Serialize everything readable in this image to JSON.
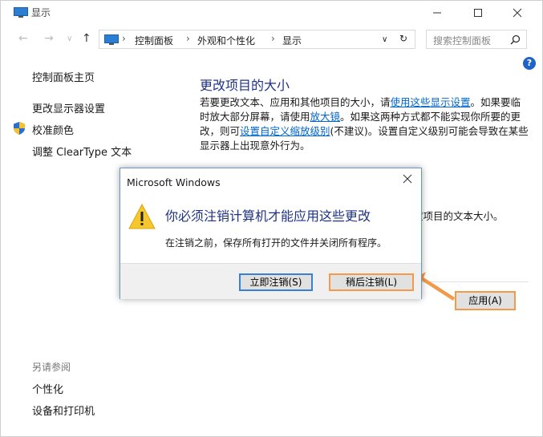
{
  "window": {
    "title": "显示"
  },
  "address": {
    "crumbs": [
      "控制面板",
      "外观和个性化",
      "显示"
    ],
    "search_placeholder": "搜索控制面板"
  },
  "sidebar": {
    "home": "控制面板主页",
    "items": [
      "更改显示器设置",
      "校准颜色",
      "调整 ClearType 文本"
    ],
    "see_also_title": "另请参阅",
    "see_also": [
      "个性化",
      "设备和打印机"
    ]
  },
  "main": {
    "title": "更改项目的大小",
    "para_1": "若要更改文本、应用和其他项目的大小，请",
    "link_1": "使用这些显示设置",
    "para_2": "。如果要临时放大部分屏幕，请使用",
    "link_2": "放大镜",
    "para_3": "。如果这两种方式都不能实现你所要的更改，则可",
    "link_3": "设置自定义缩放级别",
    "para_4": "(不建议)。设置自定义级别可能会导致在某些显示器上出现意外行为。",
    "partial_text": "定项目的文本大小。",
    "apply_button": "应用(A)"
  },
  "dialog": {
    "title": "Microsoft Windows",
    "heading": "你必须注销计算机才能应用这些更改",
    "body": "在注销之前，保存所有打开的文件并关闭所有程序。",
    "btn_now": "立即注销(S)",
    "btn_later": "稍后注销(L)"
  },
  "colors": {
    "accent": "#1e3287",
    "link": "#0066cc",
    "highlight": "#f39a4a"
  }
}
